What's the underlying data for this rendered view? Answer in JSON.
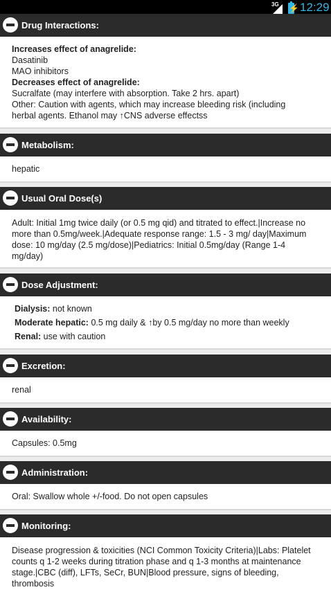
{
  "status": {
    "network": "3G",
    "time": "12:29"
  },
  "sections": {
    "drug_interactions": {
      "title": "Drug Interactions:",
      "inc_heading": "Increases effect of anagrelide:",
      "inc_1": "Dasatinib",
      "inc_2": "MAO inhibitors",
      "dec_heading": "Decreases effect of anagrelide:",
      "dec_1": "Sucralfate (may interfere with absorption. Take 2 hrs. apart)",
      "other": "Other: Caution with agents, which may increase bleeding risk (including herbal agents. Ethanol may ↑CNS adverse effectss"
    },
    "metabolism": {
      "title": "Metabolism:",
      "text": "hepatic"
    },
    "usual_oral_dose": {
      "title": "Usual Oral Dose(s)",
      "text": "Adult: Initial 1mg twice daily (or 0.5 mg qid) and titrated to effect.|Increase no more than 0.5mg/week.|Adequate response range: 1.5 - 3 mg/ day|Maximum dose: 10 mg/day (2.5 mg/dose)|Pediatrics: Initial 0.5mg/day (Range 1-4 mg/day)"
    },
    "dose_adjustment": {
      "title": "Dose Adjustment:",
      "dialysis_label": "Dialysis:",
      "dialysis_value": " not known",
      "hepatic_label": "Moderate hepatic:",
      "hepatic_value": " 0.5 mg daily & ↑by 0.5 mg/day no more than weekly",
      "renal_label": "Renal:",
      "renal_value": " use with caution"
    },
    "excretion": {
      "title": "Excretion:",
      "text": "renal"
    },
    "availability": {
      "title": "Availability:",
      "text": "Capsules: 0.5mg"
    },
    "administration": {
      "title": "Administration:",
      "text": "Oral: Swallow whole +/-food. Do not open capsules"
    },
    "monitoring": {
      "title": "Monitoring:",
      "text": "Disease progression & toxicities (NCI Common Toxicity Criteria)|Labs: Platelet counts q 1-2 weeks during titration phase and q 1-3 months at maintenance stage.|CBC (diff), LFTs, SeCr, BUN|Blood pressure, signs of bleeding, thrombosis"
    }
  }
}
